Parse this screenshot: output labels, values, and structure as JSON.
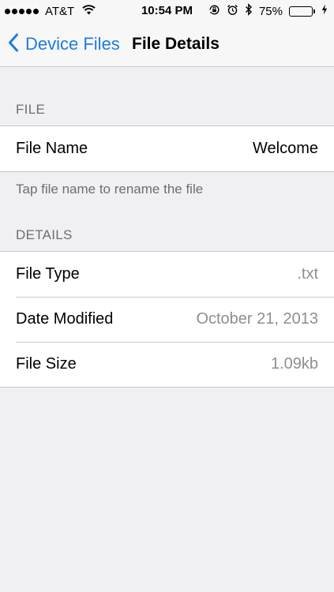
{
  "status_bar": {
    "carrier": "AT&T",
    "time": "10:54 PM",
    "battery_percent": "75%",
    "battery_level": 0.75,
    "icons": [
      "signal-dots-icon",
      "wifi-icon",
      "orientation-lock-icon",
      "alarm-icon",
      "bluetooth-icon",
      "battery-icon",
      "charging-bolt-icon"
    ]
  },
  "nav": {
    "back_label": "Device Files",
    "title": "File Details"
  },
  "sections": {
    "file": {
      "header": "FILE",
      "rows": [
        {
          "label": "File Name",
          "value": "Welcome"
        }
      ],
      "footer": "Tap file name to rename the file"
    },
    "details": {
      "header": "DETAILS",
      "rows": [
        {
          "label": "File Type",
          "value": ".txt"
        },
        {
          "label": "Date Modified",
          "value": "October 21, 2013"
        },
        {
          "label": "File Size",
          "value": "1.09kb"
        }
      ]
    }
  },
  "colors": {
    "accent": "#1f7ce0",
    "background": "#efeff4",
    "secondary_text": "#8e8e93",
    "battery_fill": "#4cd964"
  }
}
